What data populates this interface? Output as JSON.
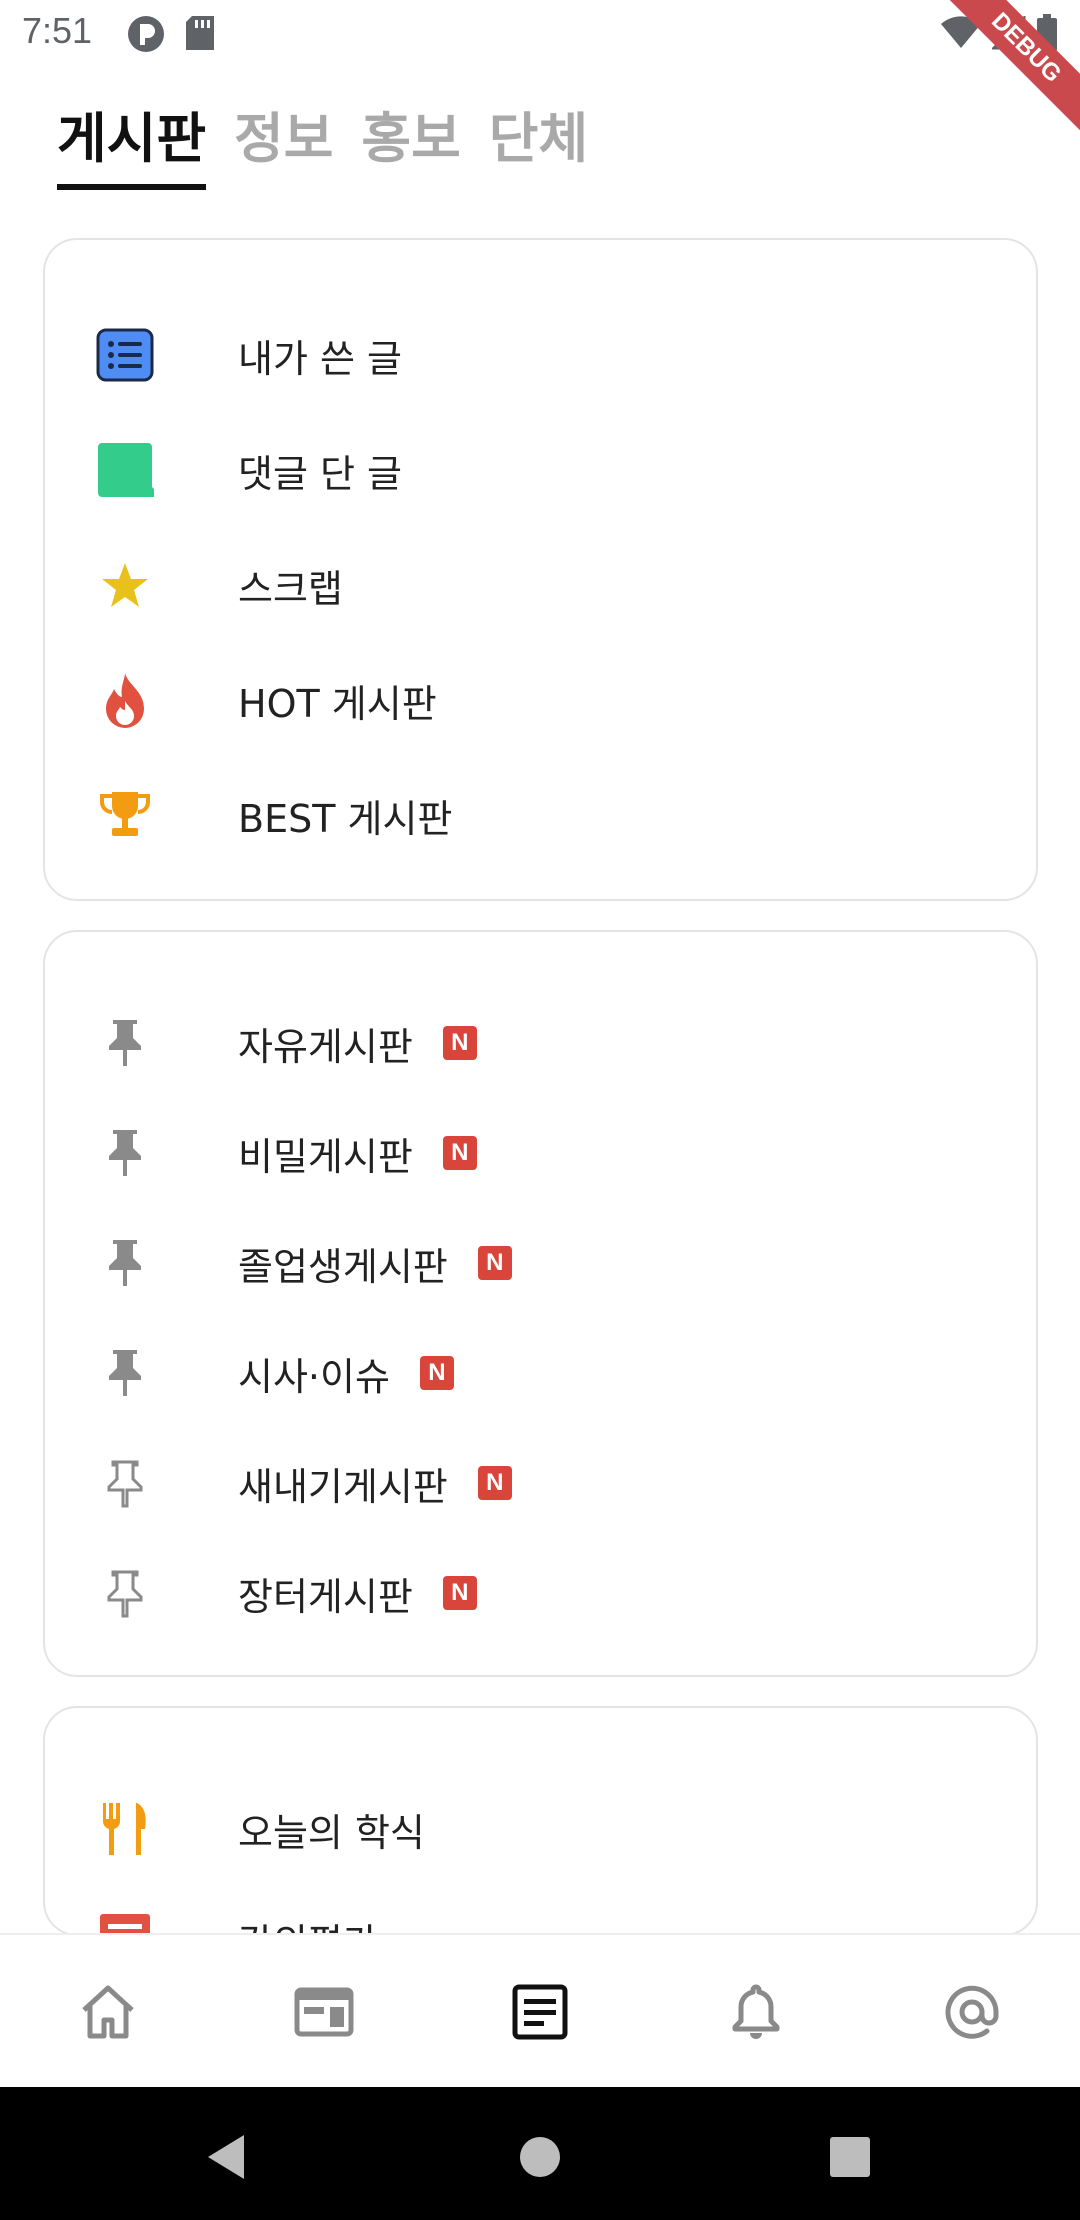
{
  "status_bar": {
    "time": "7:51",
    "left_icons": [
      "camera-notification-icon",
      "sd-card-icon"
    ],
    "right_icons": [
      "wifi-icon",
      "cell-signal-icon",
      "battery-icon"
    ]
  },
  "debug_banner": "DEBUG",
  "tabs": [
    {
      "label": "게시판",
      "active": true
    },
    {
      "label": "정보",
      "active": false
    },
    {
      "label": "홍보",
      "active": false
    },
    {
      "label": "단체",
      "active": false
    }
  ],
  "my_section": {
    "items": [
      {
        "label": "내가 쓴 글",
        "icon": "list-icon"
      },
      {
        "label": "댓글 단 글",
        "icon": "comment-icon"
      },
      {
        "label": "스크랩",
        "icon": "star-icon"
      },
      {
        "label": "HOT 게시판",
        "icon": "fire-icon"
      },
      {
        "label": "BEST 게시판",
        "icon": "trophy-icon"
      }
    ]
  },
  "boards_section": {
    "items": [
      {
        "label": "자유게시판",
        "badge": "N",
        "pinned": true
      },
      {
        "label": "비밀게시판",
        "badge": "N",
        "pinned": true
      },
      {
        "label": "졸업생게시판",
        "badge": "N",
        "pinned": true
      },
      {
        "label": "시사·이슈",
        "badge": "N",
        "pinned": true
      },
      {
        "label": "새내기게시판",
        "badge": "N",
        "pinned": false
      },
      {
        "label": "장터게시판",
        "badge": "N",
        "pinned": false
      }
    ]
  },
  "campus_section": {
    "items": [
      {
        "label": "오늘의 학식",
        "icon": "utensils-icon"
      },
      {
        "label": "강의평가",
        "icon": "lecture-review-icon"
      }
    ]
  },
  "bottom_nav": [
    {
      "icon": "home-icon",
      "active": false
    },
    {
      "icon": "timetable-icon",
      "active": false
    },
    {
      "icon": "board-icon",
      "active": true
    },
    {
      "icon": "bell-icon",
      "active": false
    },
    {
      "icon": "at-sign-icon",
      "active": false
    }
  ],
  "colors": {
    "accent": "#111111",
    "inactive_tab": "#a9a9a9",
    "badge": "#d9453a",
    "list_icon": "#4f8df5",
    "comment_icon": "#33cc8a",
    "star_icon": "#e8c21a",
    "fire_icon": "#e0513f",
    "trophy_icon": "#f39c12",
    "pin_icon": "#8a8a8a"
  }
}
